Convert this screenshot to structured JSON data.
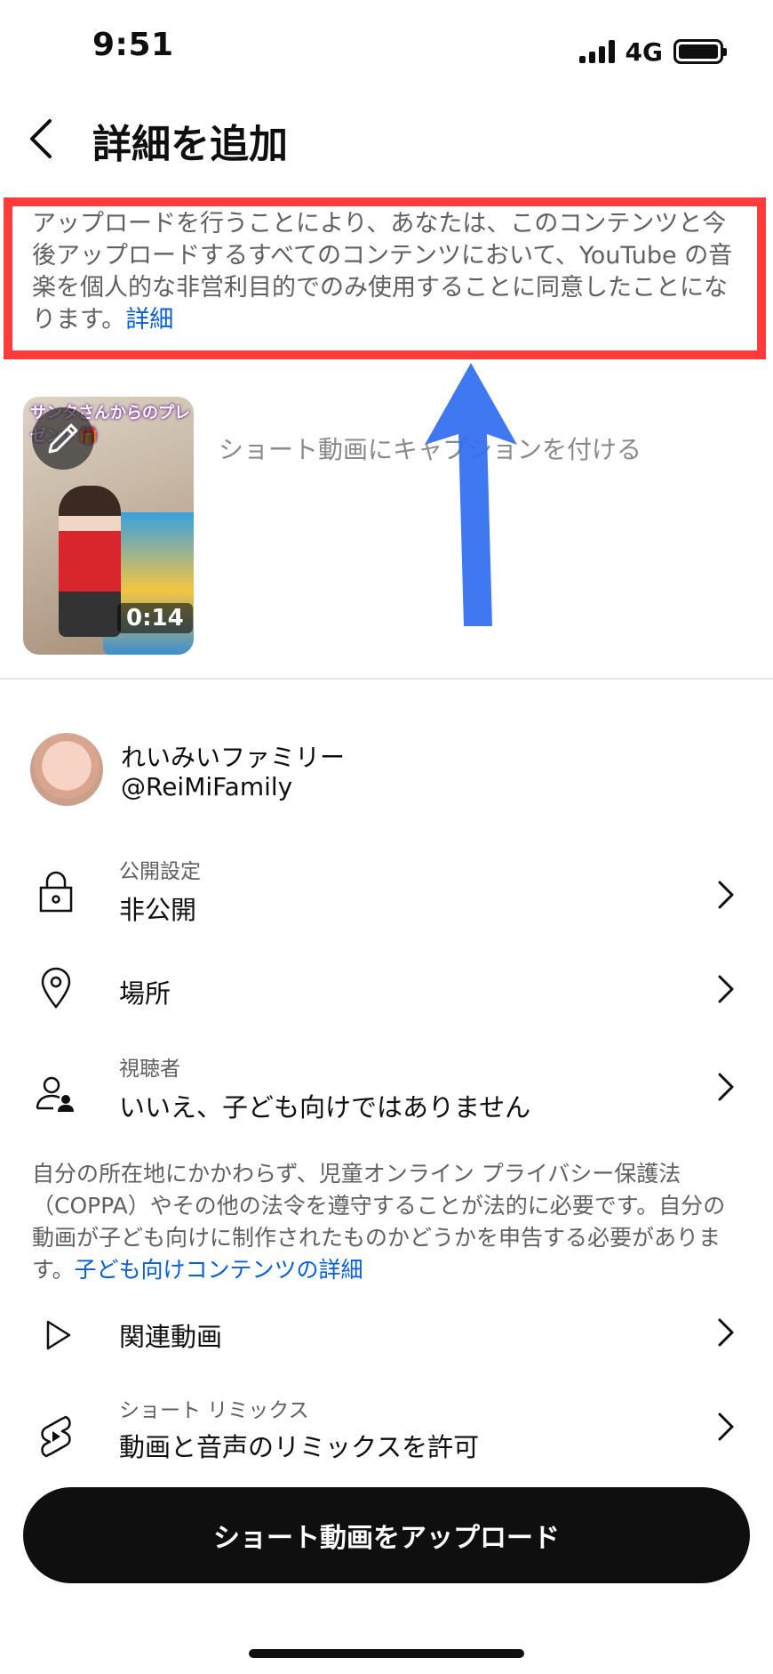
{
  "status_bar": {
    "time": "9:51",
    "network": "4G",
    "icons": [
      "signal-icon",
      "battery-icon"
    ]
  },
  "header": {
    "back_icon": "chevron-left-icon",
    "title": "詳細を追加"
  },
  "notice": {
    "text": "アップロードを行うことにより、あなたは、このコンテンツと今後アップロードするすべてのコンテンツにおいて、YouTube の音楽を個人的な非営利目的でのみ使用することに同意したことになります。",
    "link": "詳細",
    "highlight_color": "#ff3b3b",
    "annotation_arrow_color": "#2f6df0"
  },
  "video": {
    "thumbnail_text": "サンタさんからのプレゼント🎁",
    "duration": "0:14",
    "edit_icon": "pencil-icon",
    "caption_placeholder": "ショート動画にキャプションを付ける"
  },
  "account": {
    "name": "れいみいファミリー",
    "handle": "@ReiMiFamily"
  },
  "rows": {
    "visibility": {
      "label": "公開設定",
      "value": "非公開",
      "icon": "lock-icon"
    },
    "location": {
      "value": "場所",
      "icon": "location-pin-icon"
    },
    "audience": {
      "label": "視聴者",
      "value": "いいえ、子ども向けではありません",
      "icon": "audience-icon"
    },
    "related": {
      "value": "関連動画",
      "icon": "play-icon"
    },
    "remix": {
      "label": "ショート リミックス",
      "value": "動画と音声のリミックスを許可",
      "icon": "shorts-remix-icon"
    }
  },
  "coppa": {
    "text": "自分の所在地にかかわらず、児童オンライン プライバシー保護法（COPPA）やその他の法令を遵守することが法的に必要です。自分の動画が子ども向けに制作されたものかどうかを申告する必要があります。",
    "link": "子ども向けコンテンツの詳細"
  },
  "upload_button": "ショート動画をアップロード",
  "colors": {
    "accent_link": "#065fd4",
    "primary_button": "#0f0f0f"
  }
}
